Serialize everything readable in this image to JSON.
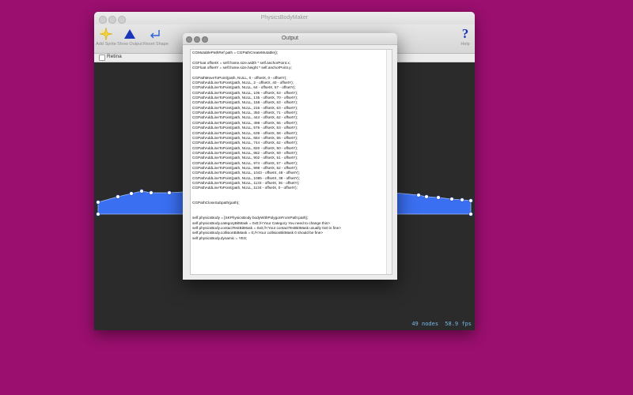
{
  "main_window": {
    "title": "PhysicsBodyMaker",
    "toolbar": {
      "add_sprite": {
        "label": "Add Sprite",
        "icon": "sparkle-icon"
      },
      "show_output": {
        "label": "Show Output",
        "icon": "triangle-icon"
      },
      "reset_shape": {
        "label": "Reset Shape",
        "icon": "return-arrow-icon"
      },
      "help": {
        "label": "Help",
        "glyph": "?",
        "icon": "question-icon"
      }
    },
    "retina_label": "Retina",
    "retina_checked": false,
    "stats": {
      "nodes": "49 nodes",
      "fps": "58.9 fps"
    }
  },
  "output_window": {
    "title": "Output",
    "code_lines": [
      "CGMutablePathRef path = CGPathCreateMutable();",
      "",
      "CGFloat offsetX = self.frame.size.width * self.anchorPoint.x;",
      "CGFloat offsetY = self.frame.size.height * self.anchorPoint.y;",
      "",
      "CGPathMoveToPoint(path, NULL, 0 - offsetX, 0 - offsetY);",
      "CGPathAddLineToPoint(path, NULL, 2 - offsetX, 40 - offsetY);",
      "CGPathAddLineToPoint(path, NULL, 64 - offsetX, 57 - offsetY);",
      "CGPathAddLineToPoint(path, NULL, 106 - offsetX, 63 - offsetY);",
      "CGPathAddLineToPoint(path, NULL, 135 - offsetX, 70 - offsetY);",
      "CGPathAddLineToPoint(path, NULL, 158 - offsetX, 63 - offsetY);",
      "CGPathAddLineToPoint(path, NULL, 216 - offsetX, 63 - offsetY);",
      "CGPathAddLineToPoint(path, NULL, 350 - offsetX, 71 - offsetY);",
      "CGPathAddLineToPoint(path, NULL, 444 - offsetX, 62 - offsetY);",
      "CGPathAddLineToPoint(path, NULL, 498 - offsetX, 66 - offsetY);",
      "CGPathAddLineToPoint(path, NULL, 576 - offsetX, 53 - offsetY);",
      "CGPathAddLineToPoint(path, NULL, 639 - offsetX, 58 - offsetY);",
      "CGPathAddLineToPoint(path, NULL, 684 - offsetX, 55 - offsetY);",
      "CGPathAddLineToPoint(path, NULL, 744 - offsetX, 62 - offsetY);",
      "CGPathAddLineToPoint(path, NULL, 820 - offsetX, 50 - offsetY);",
      "CGPathAddLineToPoint(path, NULL, 862 - offsetX, 59 - offsetY);",
      "CGPathAddLineToPoint(path, NULL, 902 - offsetX, 51 - offsetY);",
      "CGPathAddLineToPoint(path, NULL, 974 - offsetX, 57 - offsetY);",
      "CGPathAddLineToPoint(path, NULL, 998 - offsetX, 52 - offsetY);",
      "CGPathAddLineToPoint(path, NULL, 1043 - offsetX, 48 - offsetY);",
      "CGPathAddLineToPoint(path, NULL, 1085 - offsetX, 38 - offsetY);",
      "CGPathAddLineToPoint(path, NULL, 1133 - offsetX, 36 - offsetY);",
      "CGPathAddLineToPoint(path, NULL, 1134 - offsetX, 0 - offsetY);",
      "",
      "",
      "CGPathCloseSubpath(path);",
      "",
      "",
      "self.physicsBody = [SKPhysicsBody bodyWithPolygonFromPath:path];",
      "self.physicsBody.categoryBitMask = 0x0;//<Your Category You need to change this>",
      "self.physicsBody.contactTestBitMask = 0x0;//<Your contactTestBitMask usually 0x0 is fine>",
      "self.physicsBody.collisionBitMask = 0;//<Your collisionBitMask 0 should be fine>",
      "self.physicsBody.dynamic = YES;"
    ]
  },
  "colors": {
    "desktop": "#9b0f6f",
    "shape_fill": "#3b6ff2",
    "shape_stroke": "#9fc1ff",
    "stats_text": "#76b9e9"
  }
}
